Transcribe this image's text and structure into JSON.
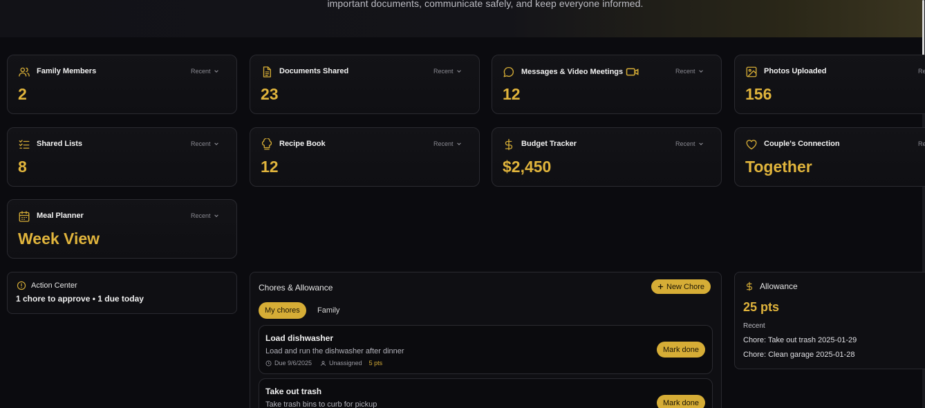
{
  "hero": {
    "text": "important documents, communicate safely, and keep everyone informed."
  },
  "stats": [
    {
      "title": "Family Members",
      "recent": "Recent",
      "value": "2",
      "icon": "users-icon"
    },
    {
      "title": "Documents Shared",
      "recent": "Recent",
      "value": "23",
      "icon": "document-icon"
    },
    {
      "title": "Messages & Video Meetings",
      "recent": "Recent",
      "value": "12",
      "icon": "message-icon"
    },
    {
      "title": "Photos Uploaded",
      "recent": "Recent",
      "value": "156",
      "icon": "image-icon"
    },
    {
      "title": "Shared Lists",
      "recent": "Recent",
      "value": "8",
      "icon": "list-icon"
    },
    {
      "title": "Recipe Book",
      "recent": "Recent",
      "value": "12",
      "icon": "chef-hat-icon"
    },
    {
      "title": "Budget Tracker",
      "recent": "Recent",
      "value": "$2,450",
      "icon": "dollar-icon"
    },
    {
      "title": "Couple's Connection",
      "recent": "Recent",
      "value": "Together",
      "icon": "heart-icon"
    },
    {
      "title": "Meal Planner",
      "recent": "Recent",
      "value": "Week View",
      "icon": "calendar-icon"
    }
  ],
  "action_center": {
    "title": "Action Center",
    "summary": "1 chore to approve • 1 due today"
  },
  "chores": {
    "title": "Chores & Allowance",
    "new_chore_label": "New Chore",
    "tabs": [
      "My chores",
      "Family"
    ],
    "items": [
      {
        "title": "Load dishwasher",
        "description": "Load and run the dishwasher after dinner",
        "due": "Due 9/6/2025",
        "assignee": "Unassigned",
        "points": "5 pts",
        "action": "Mark done"
      },
      {
        "title": "Take out trash",
        "description": "Take trash bins to curb for pickup",
        "action": "Mark done"
      }
    ]
  },
  "allowance": {
    "title": "Allowance",
    "points": "25 pts",
    "recent_label": "Recent",
    "entries": [
      "Chore: Take out trash 2025-01-29",
      "Chore: Clean garage 2025-01-28"
    ]
  },
  "colors": {
    "accent": "#d6ad36",
    "background": "#0b0b0f",
    "card": "#131317"
  }
}
